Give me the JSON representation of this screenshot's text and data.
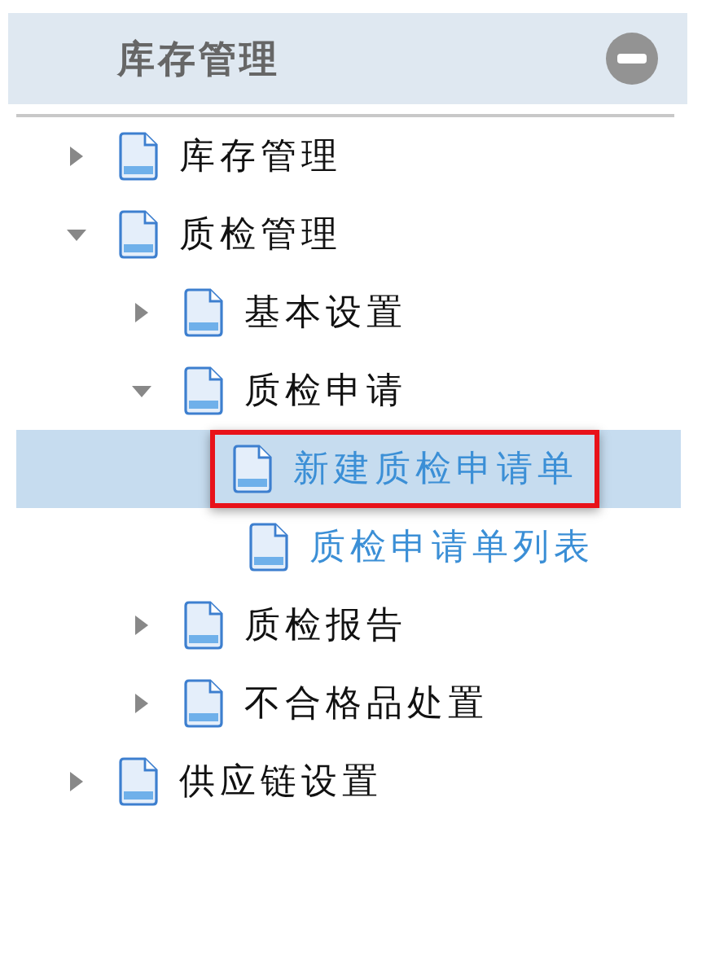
{
  "panel": {
    "title": "库存管理"
  },
  "tree": [
    {
      "label": "库存管理",
      "kind": "folder",
      "expanded": false,
      "selected": false
    },
    {
      "label": "质检管理",
      "kind": "folder",
      "expanded": true,
      "selected": false,
      "children": [
        {
          "label": "基本设置",
          "kind": "folder",
          "expanded": false,
          "selected": false
        },
        {
          "label": "质检申请",
          "kind": "folder",
          "expanded": true,
          "selected": false,
          "children": [
            {
              "label": "新建质检申请单",
              "kind": "leaf",
              "selected": true,
              "highlighted": true
            },
            {
              "label": "质检申请单列表",
              "kind": "leaf",
              "selected": false,
              "highlighted": false
            }
          ]
        },
        {
          "label": "质检报告",
          "kind": "folder",
          "expanded": false,
          "selected": false
        },
        {
          "label": "不合格品处置",
          "kind": "folder",
          "expanded": false,
          "selected": false
        }
      ]
    },
    {
      "label": "供应链设置",
      "kind": "folder",
      "expanded": false,
      "selected": false
    }
  ]
}
